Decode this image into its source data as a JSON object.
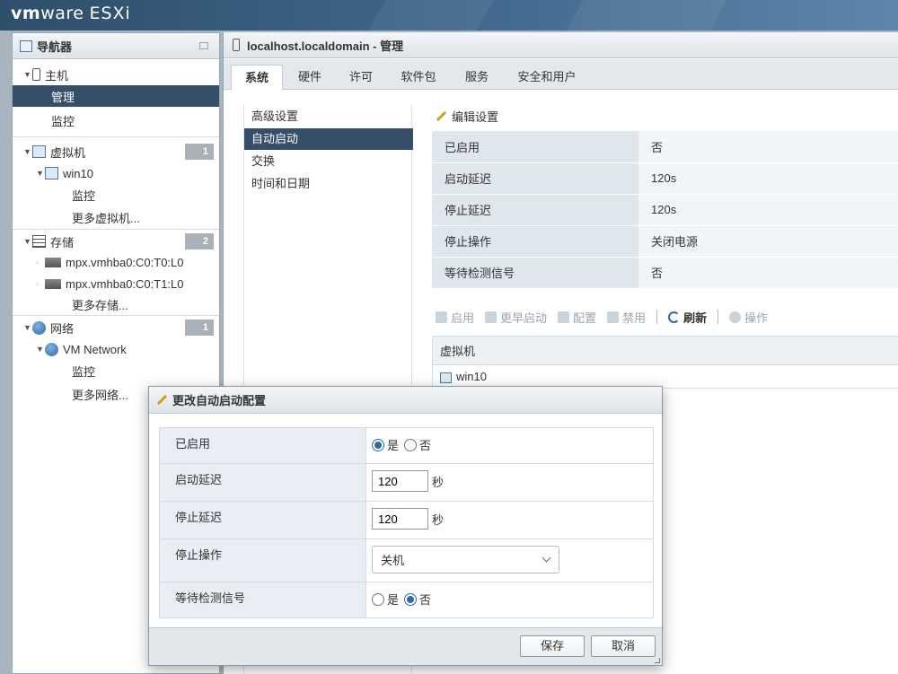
{
  "header": {
    "brand_vm": "vm",
    "brand_ware": "ware",
    "brand_esxi": "ESXi"
  },
  "navigator": {
    "title": "导航器",
    "host": {
      "label": "主机",
      "children": [
        "管理",
        "监控"
      ]
    },
    "vms": {
      "label": "虚拟机",
      "count": "1",
      "vm_name": "win10",
      "vm_children": [
        "监控"
      ],
      "more": "更多虚拟机..."
    },
    "storage": {
      "label": "存储",
      "count": "2",
      "devices": [
        "mpx.vmhba0:C0:T0:L0",
        "mpx.vmhba0:C0:T1:L0"
      ],
      "more": "更多存储..."
    },
    "network": {
      "label": "网络",
      "count": "1",
      "net_name": "VM Network",
      "net_children": [
        "监控"
      ],
      "more": "更多网络..."
    }
  },
  "main": {
    "title": "localhost.localdomain - 管理",
    "tabs": [
      "系统",
      "硬件",
      "许可",
      "软件包",
      "服务",
      "安全和用户"
    ],
    "subnav": [
      "高级设置",
      "自动启动",
      "交换",
      "时间和日期"
    ],
    "edit_settings": "编辑设置",
    "settings": [
      {
        "k": "已启用",
        "v": "否"
      },
      {
        "k": "启动延迟",
        "v": "120s"
      },
      {
        "k": "停止延迟",
        "v": "120s"
      },
      {
        "k": "停止操作",
        "v": "关闭电源"
      },
      {
        "k": "等待检测信号",
        "v": "否"
      }
    ],
    "toolbar": [
      "启用",
      "更早启动",
      "配置",
      "禁用",
      "刷新",
      "操作"
    ],
    "vm_table": {
      "header": "虚拟机",
      "rows": [
        "win10"
      ]
    }
  },
  "dialog": {
    "title": "更改自动启动配置",
    "enabled_label": "已启用",
    "yes": "是",
    "no": "否",
    "start_delay_label": "启动延迟",
    "start_delay_value": "120",
    "stop_delay_label": "停止延迟",
    "stop_delay_value": "120",
    "unit": "秒",
    "stop_action_label": "停止操作",
    "stop_action_value": "关机",
    "heartbeat_label": "等待检测信号",
    "save": "保存",
    "cancel": "取消"
  }
}
